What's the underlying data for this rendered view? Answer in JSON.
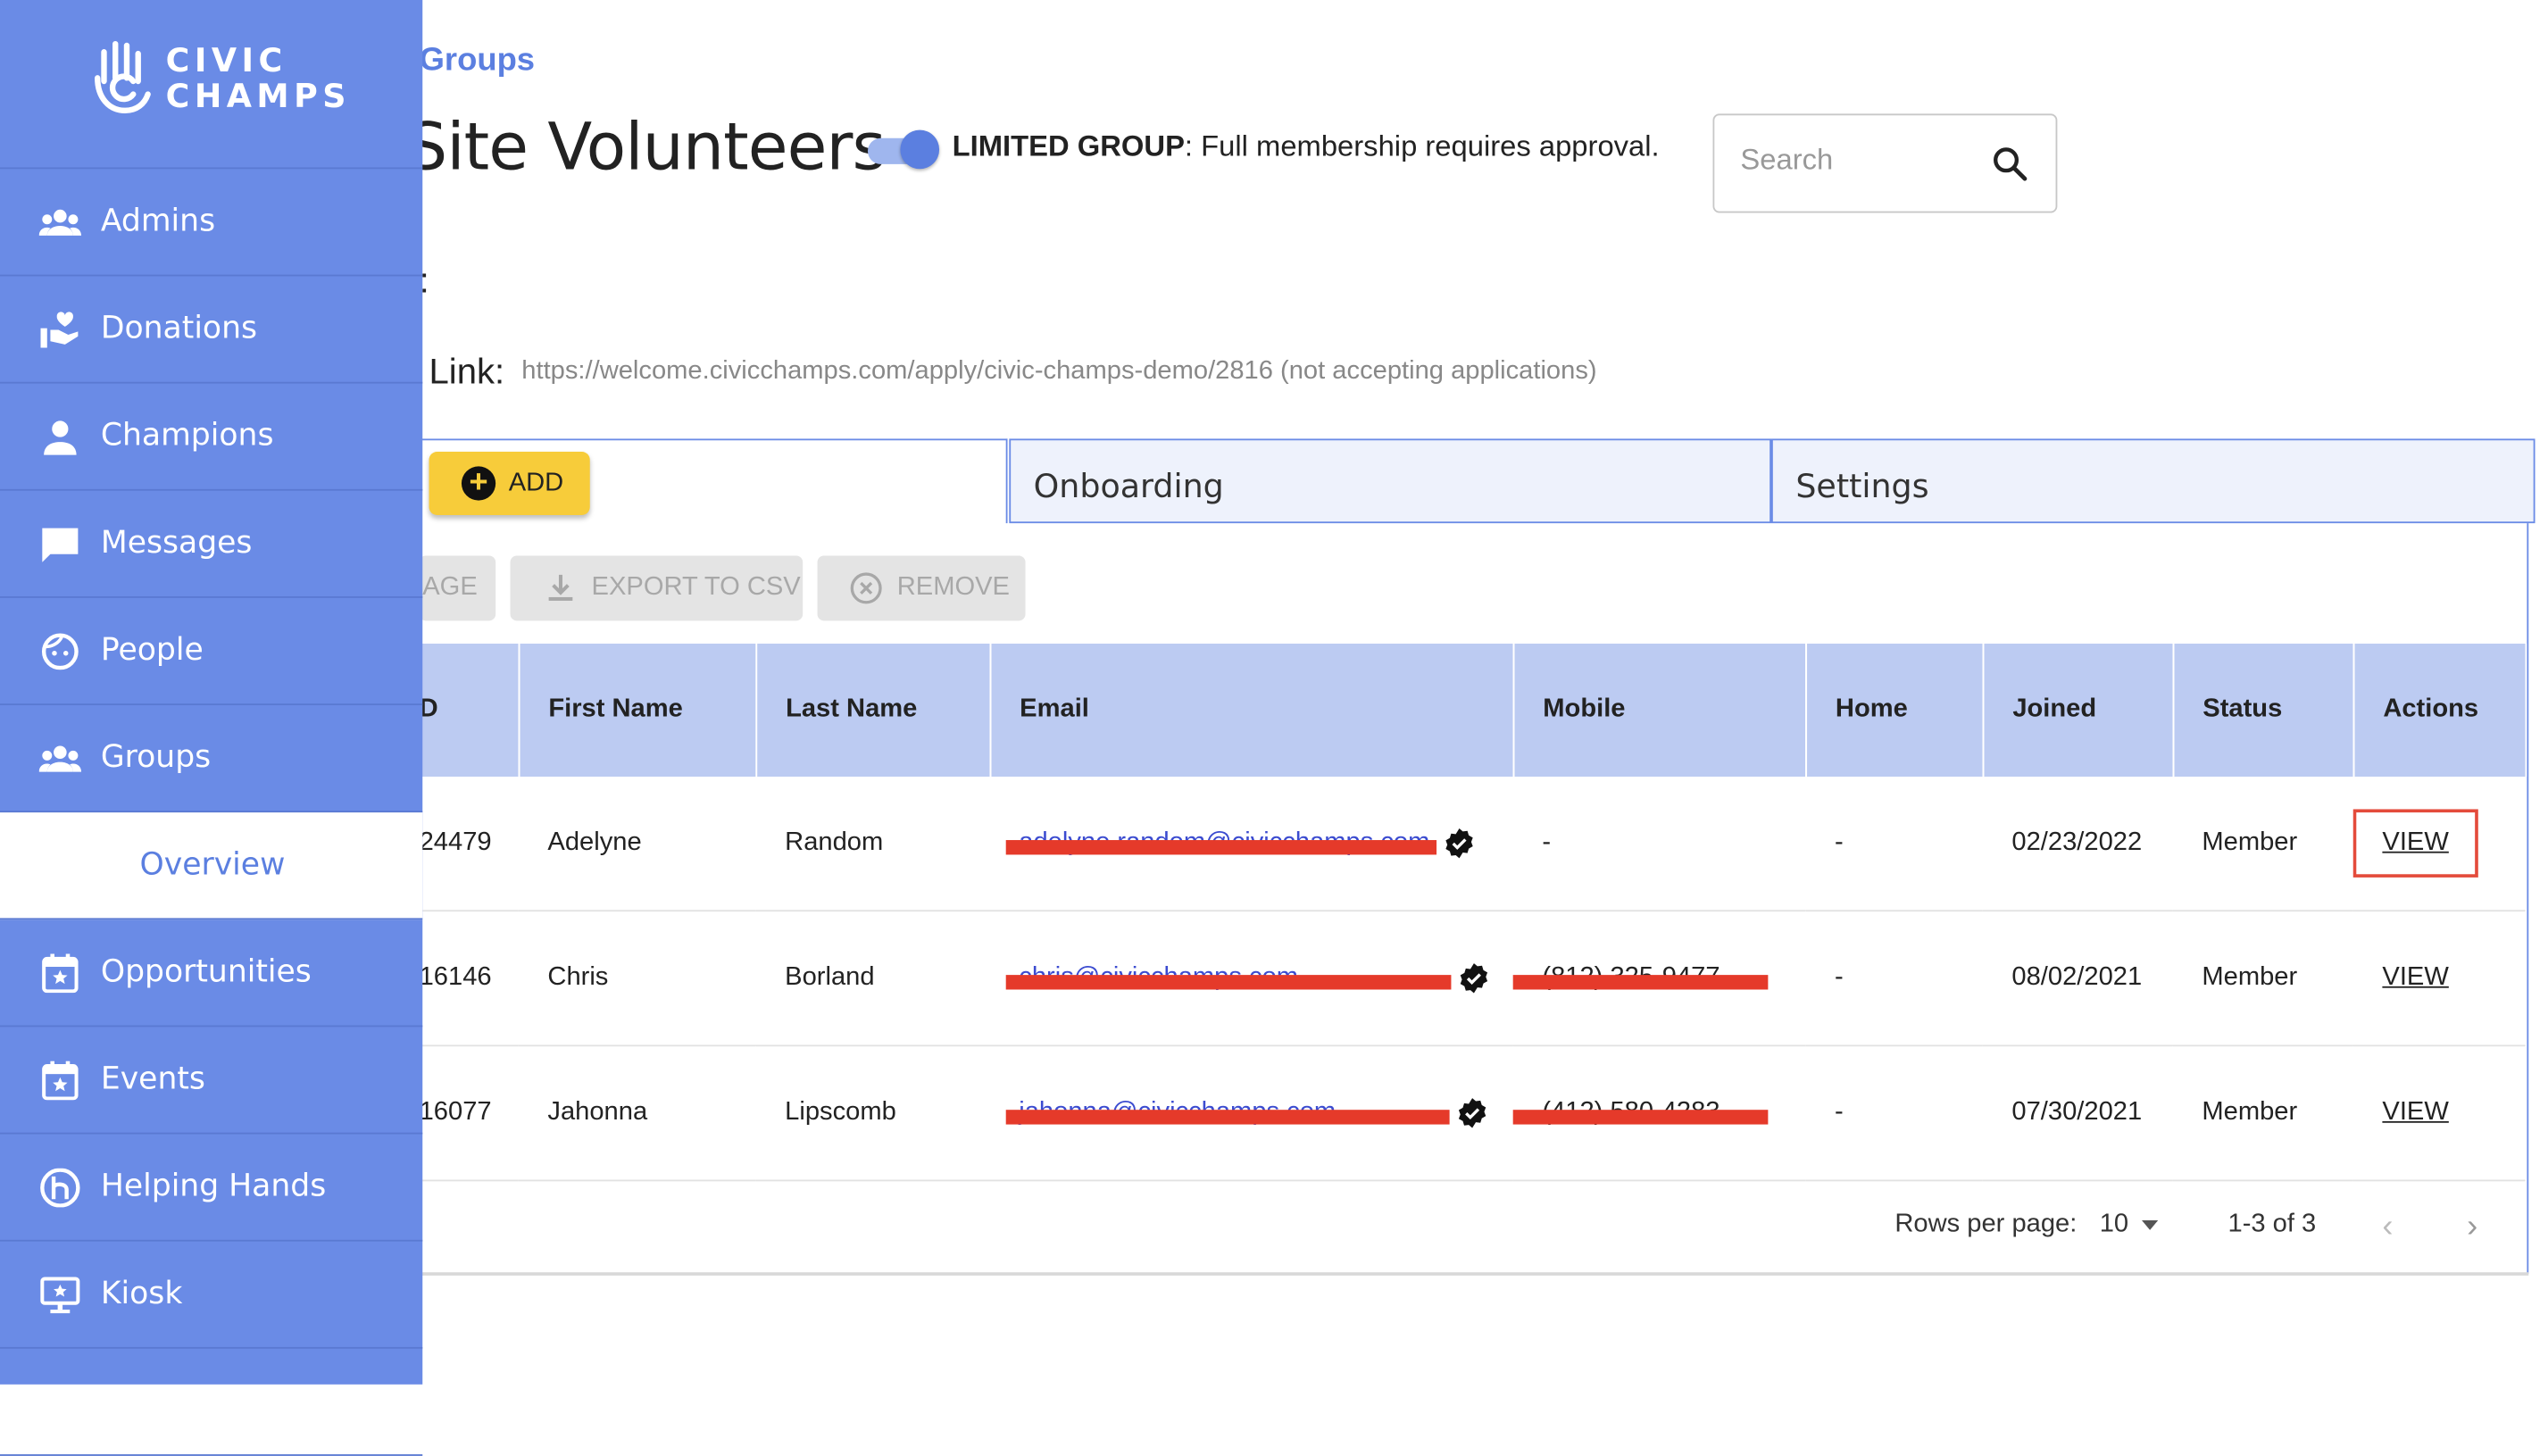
{
  "brand": {
    "line1": "CIVIC",
    "line2": "CHAMPS"
  },
  "sidebar": {
    "items": [
      {
        "label": "Admins",
        "icon": "admins-icon"
      },
      {
        "label": "Donations",
        "icon": "donations-icon"
      },
      {
        "label": "Champions",
        "icon": "person-icon"
      },
      {
        "label": "Messages",
        "icon": "message-icon"
      },
      {
        "label": "People",
        "icon": "face-icon"
      },
      {
        "label": "Groups",
        "icon": "groups-icon"
      },
      {
        "label": "Overview",
        "icon": ""
      },
      {
        "label": "Opportunities",
        "icon": "calendar-star-icon"
      },
      {
        "label": "Events",
        "icon": "calendar-star-icon"
      },
      {
        "label": "Helping Hands",
        "icon": "helping-hands-icon"
      },
      {
        "label": "Kiosk",
        "icon": "kiosk-icon"
      }
    ],
    "active_sub": "Overview"
  },
  "breadcrumb": "Groups",
  "page": {
    "title": "Site Volunteers",
    "limited_label": "LIMITED GROUP",
    "limited_text": ": Full membership requires approval.",
    "limited_enabled": true,
    "colon_label": ":",
    "link_label": "Link:",
    "link_url": "https://welcome.civicchamps.com/apply/civic-champs-demo/2816 (not accepting applications)"
  },
  "search": {
    "placeholder": "Search"
  },
  "tabs": [
    {
      "label": "",
      "active": true
    },
    {
      "label": "Onboarding",
      "active": false
    },
    {
      "label": "Settings",
      "active": false
    }
  ],
  "toolbar": {
    "add_label": "ADD",
    "message_label": "AGE",
    "export_label": "EXPORT TO CSV",
    "remove_label": "REMOVE"
  },
  "table": {
    "columns": [
      "D",
      "First Name",
      "Last Name",
      "Email",
      "Mobile",
      "Home",
      "Joined",
      "Status",
      "Actions"
    ],
    "rows": [
      {
        "id": "24479",
        "first": "Adelyne",
        "last": "Random",
        "email": "adelyne.random@civicchamps.com",
        "mobile": "-",
        "home": "-",
        "joined": "02/23/2022",
        "status": "Member",
        "action": "VIEW"
      },
      {
        "id": "16146",
        "first": "Chris",
        "last": "Borland",
        "email": "chris@civicchamps.com",
        "mobile": "(812) 325-9477",
        "home": "-",
        "joined": "08/02/2021",
        "status": "Member",
        "action": "VIEW"
      },
      {
        "id": "16077",
        "first": "Jahonna",
        "last": "Lipscomb",
        "email": "jahonna@civicchamps.com",
        "mobile": "(412) 580-4283",
        "home": "-",
        "joined": "07/30/2021",
        "status": "Member",
        "action": "VIEW"
      }
    ]
  },
  "pagination": {
    "rows_per_page_label": "Rows per page:",
    "rows_per_page": "10",
    "range": "1-3 of 3"
  },
  "colors": {
    "sidebar": "#6a8be6",
    "accent": "#5b7fe0",
    "add_button": "#f7cc3a",
    "table_header": "#bccbf2",
    "redaction": "#e53a2a"
  }
}
